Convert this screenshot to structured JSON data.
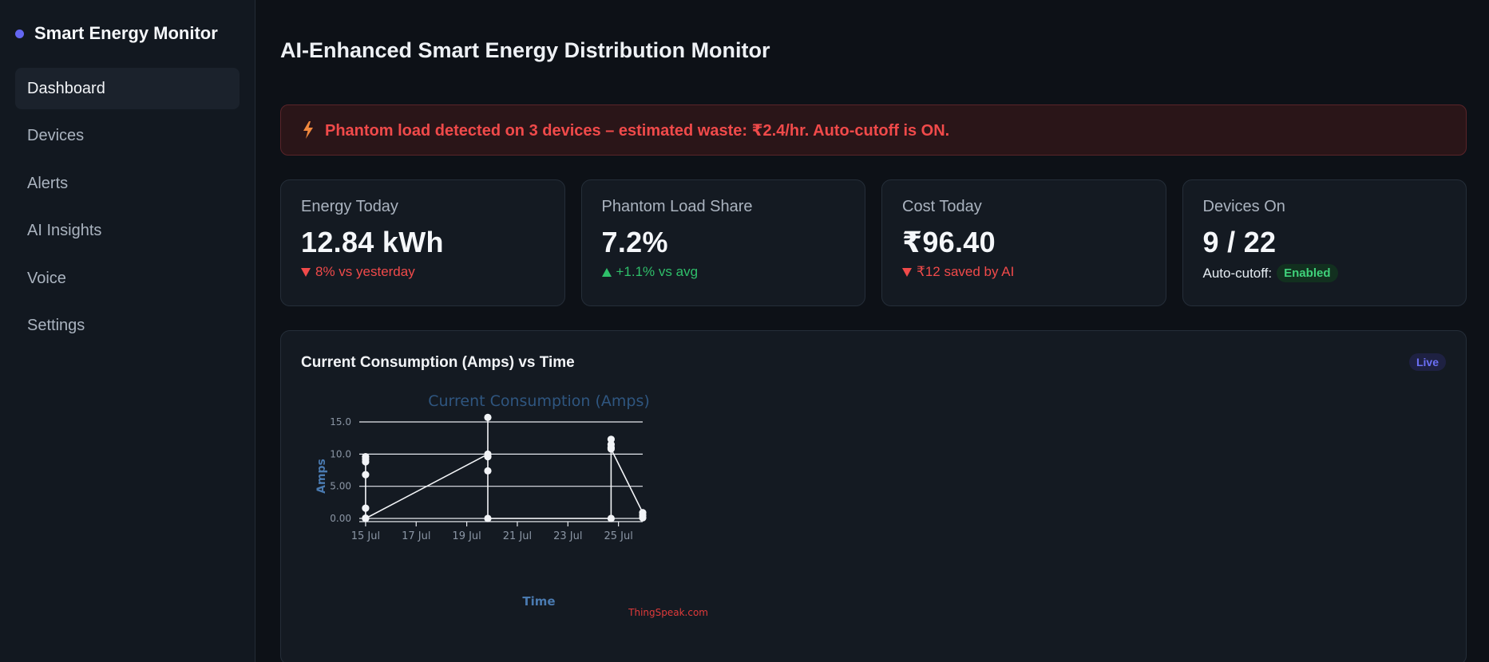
{
  "sidebar": {
    "brand": "Smart Energy Monitor",
    "items": [
      {
        "label": "Dashboard",
        "active": true
      },
      {
        "label": "Devices",
        "active": false
      },
      {
        "label": "Alerts",
        "active": false
      },
      {
        "label": "AI Insights",
        "active": false
      },
      {
        "label": "Voice",
        "active": false
      },
      {
        "label": "Settings",
        "active": false
      }
    ]
  },
  "header": {
    "title": "AI-Enhanced Smart Energy Distribution Monitor"
  },
  "alert": {
    "icon": "bolt-icon",
    "text": "Phantom load detected on 3 devices – estimated waste: ₹2.4/hr. Auto-cutoff is ON."
  },
  "cards": [
    {
      "label": "Energy Today",
      "value": "12.84 kWh",
      "delta": "8% vs yesterday",
      "direction": "down"
    },
    {
      "label": "Phantom Load Share",
      "value": "7.2%",
      "delta": "+1.1% vs avg",
      "direction": "up"
    },
    {
      "label": "Cost Today",
      "value": "₹96.40",
      "delta": "₹12 saved by AI",
      "direction": "down"
    },
    {
      "label": "Devices On",
      "value": "9 / 22",
      "autocutoff_label": "Auto-cutoff:",
      "autocutoff_status": "Enabled"
    }
  ],
  "chart_panel": {
    "title": "Current Consumption (Amps) vs Time",
    "badge": "Live"
  },
  "colors": {
    "accent": "#6366f1",
    "alert_red": "#f04a4a",
    "up_green": "#2fbf6a",
    "chart_title": "#2f5680",
    "axis_label": "#4a7ab0",
    "credit_red": "#e03a3a"
  },
  "chart_data": {
    "type": "line",
    "title": "Current Consumption (Amps)",
    "xlabel": "Time",
    "ylabel": "Amps",
    "credit": "ThingSpeak.com",
    "x_ticks": [
      "15 Jul",
      "17 Jul",
      "19 Jul",
      "21 Jul",
      "23 Jul",
      "25 Jul"
    ],
    "y_ticks": [
      "0.00",
      "5.00",
      "10.0",
      "15.0"
    ],
    "xlim": [
      "2024-07-14T18:00",
      "2024-07-25T23:00"
    ],
    "ylim": [
      0,
      15.5
    ],
    "grid": true,
    "series": [
      {
        "points": [
          [
            "2024-07-15T00:00",
            9.6
          ],
          [
            "2024-07-15T00:00",
            9.2
          ],
          [
            "2024-07-15T00:00",
            8.8
          ],
          [
            "2024-07-15T00:00",
            6.8
          ],
          [
            "2024-07-15T00:00",
            1.6
          ],
          [
            "2024-07-15T00:00",
            0.05
          ],
          [
            "2024-07-15T00:00",
            0.0
          ],
          [
            "2024-07-19T20:00",
            10.0
          ],
          [
            "2024-07-19T20:00",
            9.6
          ],
          [
            "2024-07-19T20:00",
            7.4
          ],
          [
            "2024-07-19T20:00",
            15.7
          ],
          [
            "2024-07-19T20:00",
            0.0
          ],
          [
            "2024-07-24T17:00",
            0.0
          ],
          [
            "2024-07-24T17:00",
            12.3
          ],
          [
            "2024-07-24T17:00",
            11.5
          ],
          [
            "2024-07-24T17:00",
            11.0
          ],
          [
            "2024-07-24T17:00",
            10.8
          ],
          [
            "2024-07-25T23:00",
            0.9
          ],
          [
            "2024-07-25T23:00",
            0.5
          ],
          [
            "2024-07-25T23:00",
            0.1
          ]
        ]
      }
    ]
  }
}
